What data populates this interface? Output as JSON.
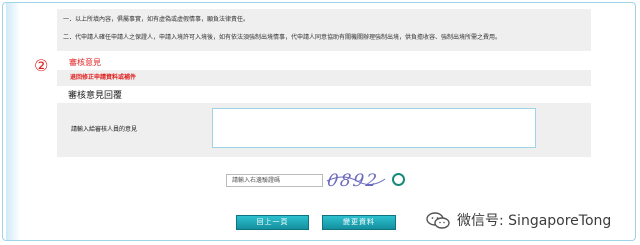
{
  "notice": {
    "line1": "一．以上所填內容，俱屬事實，如有虛偽或虛假情事，願負法律責任。",
    "line2": "二．代申請人確任申請人之保證人，申請入境許可入境後，如有依法須強制出境情事，代申請人同意協助有關機關辦理強制出境，供負擔收容、強制出境所需之費用。"
  },
  "marker": "②",
  "review": {
    "title": "審核意見",
    "message": "退回修正申請資料或補件"
  },
  "reply": {
    "title": "審核意見回覆",
    "label": "請輸入給審核人員的意見",
    "value": ""
  },
  "captcha": {
    "placeholder": "請輸入右邊驗證碼",
    "image_text": "0892"
  },
  "buttons": {
    "back": "回上一頁",
    "change": "變更資料"
  },
  "watermark": {
    "text": "微信号: SingaporeTong"
  },
  "colors": {
    "accent_red": "#e02020",
    "button_teal": "#1aa6b5",
    "border_blue": "#9fd3ea",
    "panel_gray": "#efefef"
  },
  "icons": {
    "refresh": "refresh-icon",
    "wechat": "wechat-icon"
  }
}
